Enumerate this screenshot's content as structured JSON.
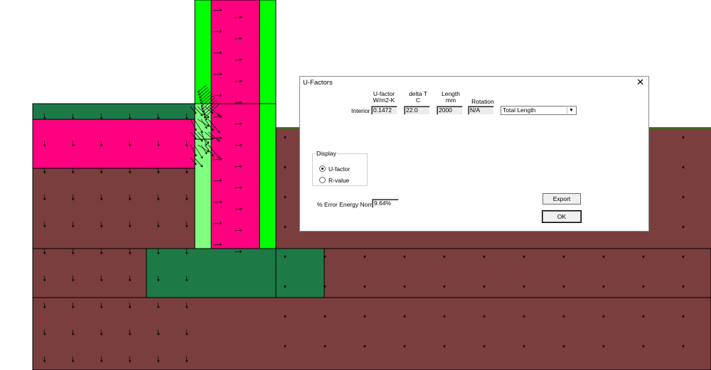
{
  "dialog": {
    "title": "U-Factors",
    "close_glyph": "✕",
    "columns": {
      "ufactor": [
        "U-factor",
        "W/m2-K"
      ],
      "delta_t": [
        "delta T",
        "C"
      ],
      "length": [
        "Length",
        "mm"
      ],
      "rotation": "Rotation"
    },
    "row_label": "Interior",
    "ufactor_value": "0.1472",
    "delta_t_value": "22.0",
    "length_value": "2000",
    "rotation_value": "N/A",
    "length_mode": "Total Length",
    "display_group": {
      "label": "Display",
      "options": [
        "U-factor",
        "R-value"
      ],
      "selected": "U-factor"
    },
    "error_label": "% Error Energy Norm",
    "error_value": "9.64%",
    "export_label": "Export",
    "ok_label": "OK"
  },
  "colors": {
    "soil": "#7a3e3e",
    "insulation_pink": "#ff0080",
    "bright_green": "#00ff00",
    "light_green": "#80ff80",
    "dark_green": "#1d7a46",
    "arrow": "#000000"
  }
}
